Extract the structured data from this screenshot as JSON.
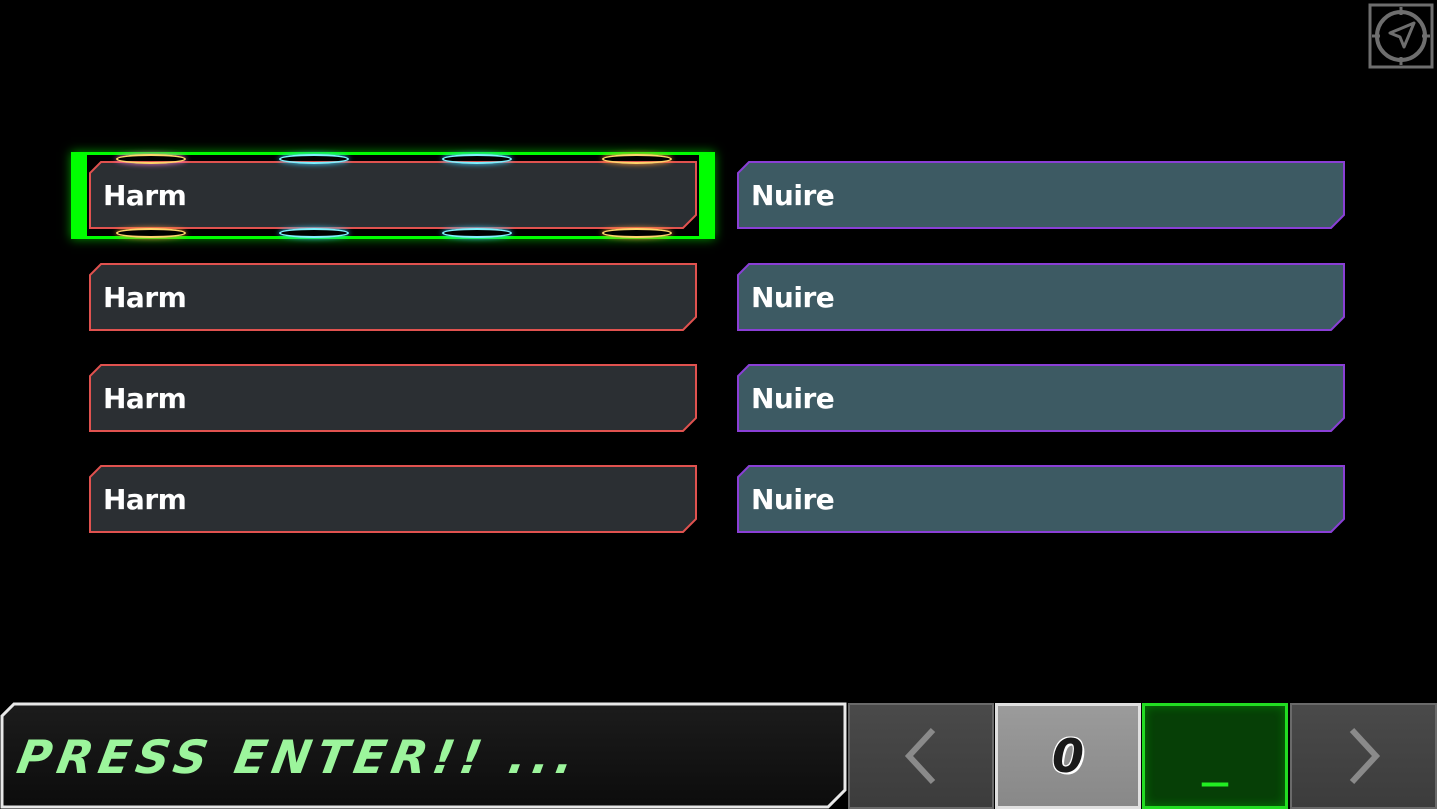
{
  "options": {
    "left": [
      {
        "label": "Harm"
      },
      {
        "label": "Harm"
      },
      {
        "label": "Harm"
      },
      {
        "label": "Harm"
      }
    ],
    "right": [
      {
        "label": "Nuire"
      },
      {
        "label": "Nuire"
      },
      {
        "label": "Nuire"
      },
      {
        "label": "Nuire"
      }
    ],
    "selected": "left-0"
  },
  "prompt": {
    "text": "PRESS ENTER!! ..."
  },
  "controls": {
    "counter_value": "0",
    "entry_value": "_",
    "prev_icon": "chevron-left-icon",
    "next_icon": "chevron-right-icon"
  },
  "icons": {
    "nav": "navigation-arrow-icon"
  },
  "colors": {
    "left_border": "#e0524f",
    "left_fill": "#2b2f33",
    "right_border": "#8a3fd6",
    "right_fill": "#3d5a63",
    "selection": "#00ff00",
    "prompt_text": "#9cf59c",
    "entry_border": "#22dd22"
  }
}
